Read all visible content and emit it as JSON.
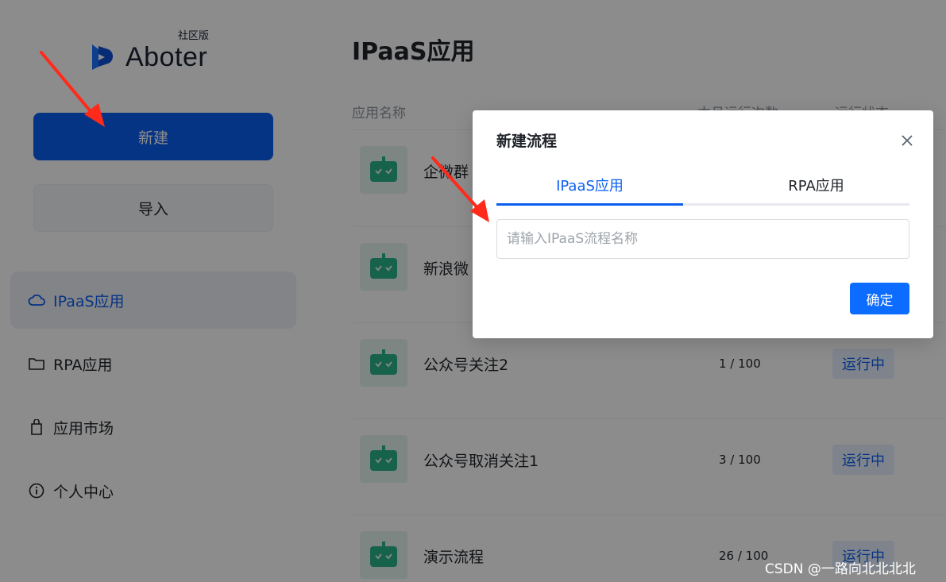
{
  "sidebar": {
    "logo_text": "Aboter",
    "logo_tag": "社区版",
    "new_button": "新建",
    "import_button": "导入",
    "nav": [
      {
        "label": "IPaaS应用",
        "icon": "cloud-icon",
        "active": true
      },
      {
        "label": "RPA应用",
        "icon": "folder-icon",
        "active": false
      },
      {
        "label": "应用市场",
        "icon": "shopping-bag-icon",
        "active": false
      },
      {
        "label": "个人中心",
        "icon": "info-icon",
        "active": false
      }
    ]
  },
  "main": {
    "title": "IPaaS应用",
    "columns": {
      "name": "应用名称",
      "runs": "本月运行次数",
      "status": "运行状态"
    },
    "rows": [
      {
        "name": "企微群",
        "runs": "",
        "status": ""
      },
      {
        "name": "新浪微",
        "runs": "",
        "status": ""
      },
      {
        "name": "公众号关注2",
        "runs": "1 / 100",
        "status": "运行中"
      },
      {
        "name": "公众号取消关注1",
        "runs": "3 / 100",
        "status": "运行中"
      },
      {
        "name": "演示流程",
        "runs": "26 / 100",
        "status": "运行中"
      }
    ]
  },
  "modal": {
    "title": "新建流程",
    "tabs": [
      {
        "label": "IPaaS应用",
        "active": true
      },
      {
        "label": "RPA应用",
        "active": false
      }
    ],
    "input_placeholder": "请输入IPaaS流程名称",
    "input_value": "",
    "confirm_button": "确定"
  },
  "watermark": "CSDN @一路向北北北北",
  "colors": {
    "primary": "#0b5ff0",
    "overlay": "rgba(0,0,0,0.45)",
    "avatar_bg": "#e6f5f0",
    "avatar_fg": "#2bb389",
    "arrow": "#ff2a1a"
  }
}
